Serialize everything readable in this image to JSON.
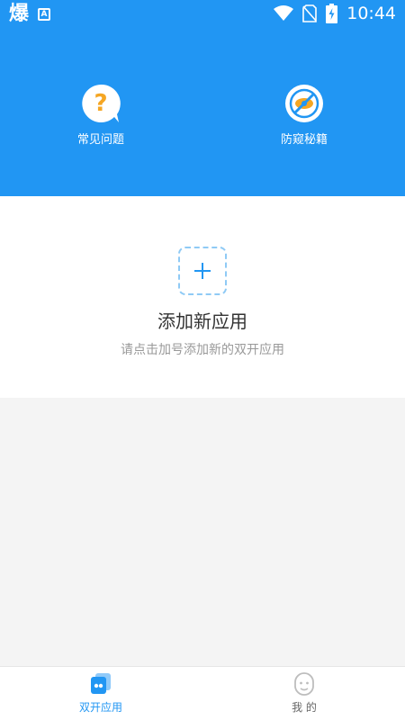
{
  "colors": {
    "primary": "#2196f3",
    "text_dark": "#333333",
    "text_muted": "#999999",
    "accent_orange": "#f5a623"
  },
  "status_bar": {
    "app_glyph": "爆",
    "notification_glyph": "A",
    "time": "10:44",
    "icons": [
      "wifi-icon",
      "no-sim-icon",
      "battery-charging-icon"
    ]
  },
  "quick_actions": {
    "faq": {
      "label": "常见问题",
      "icon": "question-bubble-icon"
    },
    "privacy": {
      "label": "防窥秘籍",
      "icon": "eye-slash-icon"
    }
  },
  "add_app": {
    "title": "添加新应用",
    "hint": "请点击加号添加新的双开应用",
    "icon": "plus-icon"
  },
  "bottom_nav": {
    "items": [
      {
        "label": "双开应用",
        "icon": "dual-apps-icon",
        "active": true
      },
      {
        "label": "我 的",
        "icon": "profile-icon",
        "active": false
      }
    ]
  }
}
